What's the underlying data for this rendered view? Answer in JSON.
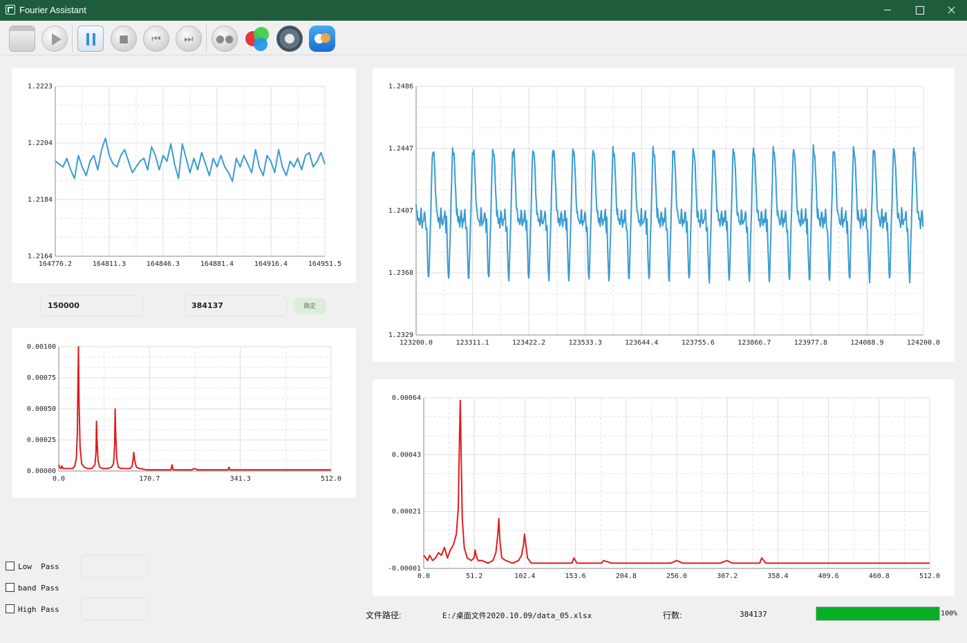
{
  "window": {
    "title": "Fourier Assistant"
  },
  "toolbar": {
    "buttons": [
      {
        "name": "open-window-button",
        "icon": "window-icon"
      },
      {
        "name": "play-button",
        "icon": "play-icon"
      },
      {
        "name": "pause-button",
        "icon": "pause-icon"
      },
      {
        "name": "stop-button",
        "icon": "stop-icon"
      },
      {
        "name": "skip-back-button",
        "icon": "skip-back-icon"
      },
      {
        "name": "skip-forward-button",
        "icon": "skip-forward-icon"
      },
      {
        "name": "dots-button",
        "icon": "dots-icon"
      },
      {
        "name": "color-button",
        "icon": "color-circles-icon"
      },
      {
        "name": "settings-button",
        "icon": "gear-icon"
      },
      {
        "name": "cloud-button",
        "icon": "cloud-icon"
      }
    ]
  },
  "range": {
    "start_value": "150000",
    "end_value": "384137",
    "confirm_label": "确定"
  },
  "filters": {
    "low_pass_label": "Low  Pass",
    "band_pass_label": "band Pass",
    "high_pass_label": "High Pass"
  },
  "status": {
    "file_path_label": "文件路径:",
    "file_path_value": "E:/桌面文件2020.10.09/data_05.xlsx",
    "rows_label": "行数:",
    "rows_value": "384137",
    "progress_percent": 100,
    "progress_text": "100%"
  },
  "colors": {
    "signal": "#3a9bd1",
    "spectrum": "#e01b1b",
    "progress": "#06b025"
  },
  "chart_data": [
    {
      "id": "signal-zoom-small",
      "type": "line",
      "color": "#3a9bd1",
      "grid": true,
      "xlim": [
        164776.2,
        164951.5
      ],
      "ylim": [
        1.2164,
        1.2223
      ],
      "xticks": [
        "164776.2",
        "164811.3",
        "164846.3",
        "164881.4",
        "164916.4",
        "164951.5"
      ],
      "yticks": [
        "1.2223",
        "1.2204",
        "1.2184",
        "1.2164"
      ],
      "x": [
        164776.2,
        164778.7,
        164781.2,
        164783.7,
        164786.2,
        164788.7,
        164791.2,
        164793.7,
        164796.3,
        164798.8,
        164801.3,
        164803.8,
        164806.3,
        164808.8,
        164811.3,
        164813.8,
        164816.3,
        164818.8,
        164821.3,
        164823.8,
        164826.3,
        164828.8,
        164831.3,
        164833.8,
        164836.3,
        164838.8,
        164841.3,
        164843.8,
        164846.3,
        164848.8,
        164851.3,
        164853.8,
        164856.3,
        164858.8,
        164861.3,
        164863.8,
        164866.3,
        164868.8,
        164871.4,
        164873.9,
        164876.4,
        164878.9,
        164881.4,
        164883.9,
        164886.4,
        164888.9,
        164891.4,
        164893.9,
        164896.4,
        164898.9,
        164901.4,
        164903.9,
        164906.4,
        164908.9,
        164911.4,
        164913.9,
        164916.4,
        164918.9,
        164921.4,
        164923.9,
        164926.4,
        164928.9,
        164931.4,
        164933.9,
        164936.4,
        164938.9,
        164941.4,
        164943.9,
        164946.5,
        164949.0,
        164951.5
      ],
      "y": [
        1.2197,
        1.2196,
        1.2195,
        1.2198,
        1.2194,
        1.2191,
        1.2199,
        1.2195,
        1.2192,
        1.2197,
        1.2199,
        1.2194,
        1.2201,
        1.2205,
        1.2199,
        1.2196,
        1.2195,
        1.2199,
        1.2201,
        1.2197,
        1.2193,
        1.2195,
        1.2197,
        1.2198,
        1.2194,
        1.2202,
        1.2199,
        1.2194,
        1.2199,
        1.2197,
        1.2203,
        1.2196,
        1.2191,
        1.2203,
        1.2198,
        1.2193,
        1.2198,
        1.2194,
        1.22,
        1.2196,
        1.2192,
        1.2198,
        1.2195,
        1.2199,
        1.2195,
        1.2193,
        1.219,
        1.2198,
        1.2195,
        1.2199,
        1.2196,
        1.2193,
        1.2201,
        1.2195,
        1.2192,
        1.2199,
        1.2197,
        1.2193,
        1.2201,
        1.2195,
        1.2192,
        1.2197,
        1.2195,
        1.2198,
        1.2194,
        1.2199,
        1.22,
        1.2195,
        1.2197,
        1.22,
        1.2196
      ]
    },
    {
      "id": "spectrum-small",
      "type": "line",
      "color": "#e01b1b",
      "grid": true,
      "xlim": [
        0.0,
        512.0
      ],
      "ylim": [
        0.0,
        0.001
      ],
      "xticks": [
        "0.0",
        "170.7",
        "341.3",
        "512.0"
      ],
      "yticks": [
        "0.00100",
        "0.00075",
        "0.00050",
        "0.00025",
        "0.00000"
      ],
      "x": [
        0,
        2,
        4,
        6,
        8,
        10,
        14,
        20,
        26,
        30,
        33,
        35,
        36,
        37,
        38,
        40,
        43,
        48,
        55,
        62,
        68,
        70,
        71,
        72,
        74,
        77,
        83,
        92,
        99,
        103,
        105,
        106,
        107,
        109,
        112,
        118,
        127,
        134,
        138,
        140,
        141,
        143,
        146,
        152,
        165,
        180,
        196,
        211,
        213,
        215,
        225,
        240,
        250,
        255,
        260,
        280,
        300,
        318,
        320,
        322,
        335,
        350,
        400,
        450,
        500,
        512
      ],
      "y": [
        5e-05,
        3e-05,
        2e-05,
        4e-05,
        2e-05,
        2e-05,
        2e-05,
        2e-05,
        2e-05,
        4e-05,
        0.0001,
        0.0003,
        0.0007,
        0.001,
        0.0006,
        0.0002,
        6e-05,
        3e-05,
        2e-05,
        2e-05,
        5e-05,
        0.00015,
        0.0004,
        0.00025,
        8e-05,
        3e-05,
        2e-05,
        2e-05,
        3e-05,
        6e-05,
        0.0002,
        0.0005,
        0.00032,
        0.0001,
        3e-05,
        2e-05,
        2e-05,
        2e-05,
        4e-05,
        0.0001,
        0.00015,
        8e-05,
        3e-05,
        2e-05,
        1e-05,
        1e-05,
        1e-05,
        1e-05,
        5e-05,
        1e-05,
        1e-05,
        1e-05,
        1e-05,
        2e-05,
        1e-05,
        1e-05,
        1e-05,
        1e-05,
        3e-05,
        1e-05,
        1e-05,
        1e-05,
        1e-05,
        1e-05,
        1e-05,
        1e-05
      ]
    },
    {
      "id": "signal-zoom-large",
      "type": "line",
      "color": "#3a9bd1",
      "grid": true,
      "xlim": [
        123200.0,
        124200.0
      ],
      "ylim": [
        1.2329,
        1.2486
      ],
      "xticks": [
        "123200.0",
        "123311.1",
        "123422.2",
        "123533.3",
        "123644.4",
        "123755.6",
        "123866.7",
        "123977.8",
        "124088.9",
        "124200.0"
      ],
      "yticks": [
        "1.2486",
        "1.2447",
        "1.2407",
        "1.2368",
        "1.2329"
      ],
      "period": 39.5,
      "phase": 19,
      "baseline": 1.2402,
      "peak": 1.2447,
      "trough": 1.2364
    },
    {
      "id": "spectrum-large",
      "type": "line",
      "color": "#e01b1b",
      "grid": true,
      "xlim": [
        0.0,
        512.0
      ],
      "ylim": [
        -1e-05,
        0.00064
      ],
      "xticks": [
        "0.0",
        "51.2",
        "102.4",
        "153.6",
        "204.8",
        "256.0",
        "307.2",
        "358.4",
        "409.6",
        "460.8",
        "512.0"
      ],
      "yticks": [
        "0.00064",
        "0.00043",
        "0.00021",
        "-0.00001"
      ],
      "x": [
        0,
        4,
        6,
        9,
        12,
        15,
        18,
        21,
        24,
        27,
        30,
        33,
        35,
        36,
        37,
        38,
        39,
        41,
        44,
        48,
        51,
        52,
        53,
        55,
        59,
        65,
        70,
        73,
        75,
        76,
        77,
        79,
        83,
        90,
        96,
        99,
        101,
        102,
        103,
        105,
        109,
        115,
        130,
        150,
        152,
        155,
        170,
        180,
        182,
        190,
        220,
        250,
        256,
        262,
        280,
        300,
        307,
        312,
        330,
        340,
        342,
        346,
        380,
        420,
        460,
        500,
        512
      ],
      "y": [
        4e-05,
        2e-05,
        4e-05,
        2e-05,
        3e-05,
        5e-05,
        4e-05,
        7e-05,
        3e-05,
        6e-05,
        8e-05,
        0.00012,
        0.00022,
        0.00045,
        0.00063,
        0.0004,
        0.00018,
        7e-05,
        3e-05,
        2e-05,
        3e-05,
        6e-05,
        4e-05,
        2e-05,
        2e-05,
        1e-05,
        2e-05,
        5e-05,
        0.00012,
        0.00018,
        0.0001,
        3e-05,
        2e-05,
        1e-05,
        2e-05,
        4e-05,
        8e-05,
        0.00012,
        9e-05,
        3e-05,
        1e-05,
        1e-05,
        1e-05,
        1e-05,
        3e-05,
        1e-05,
        1e-05,
        1e-05,
        2e-05,
        1e-05,
        1e-05,
        1e-05,
        2e-05,
        1e-05,
        1e-05,
        1e-05,
        2e-05,
        1e-05,
        1e-05,
        1e-05,
        3e-05,
        1e-05,
        1e-05,
        1e-05,
        1e-05,
        1e-05,
        1e-05
      ]
    }
  ]
}
